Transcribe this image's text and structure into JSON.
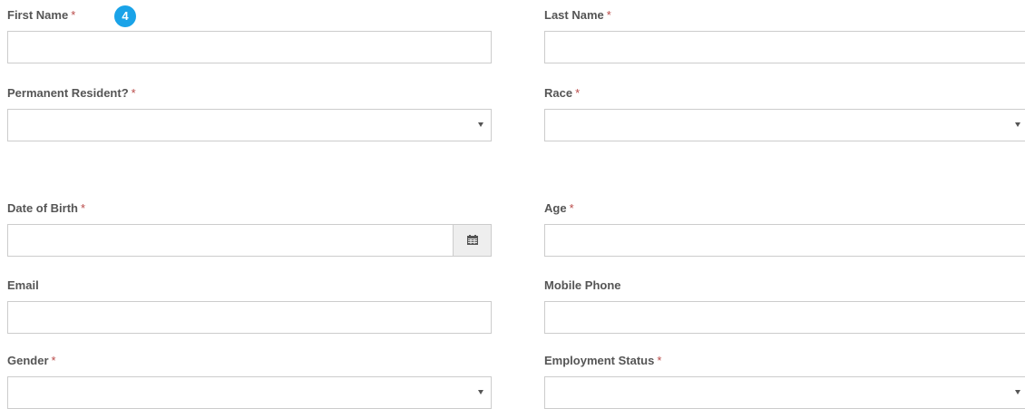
{
  "step_badge": "4",
  "required_marker": "*",
  "fields": {
    "first_name": {
      "label": "First Name",
      "value": ""
    },
    "last_name": {
      "label": "Last Name",
      "value": ""
    },
    "permanent_resident": {
      "label": "Permanent Resident?",
      "selected": ""
    },
    "race": {
      "label": "Race",
      "selected": ""
    },
    "date_of_birth": {
      "label": "Date of Birth",
      "value": "",
      "button_icon": "calendar-icon"
    },
    "age": {
      "label": "Age",
      "value": ""
    },
    "email": {
      "label": "Email",
      "value": ""
    },
    "mobile_phone": {
      "label": "Mobile Phone",
      "value": ""
    },
    "gender": {
      "label": "Gender",
      "selected": ""
    },
    "employment_status": {
      "label": "Employment Status",
      "selected": ""
    }
  },
  "colors": {
    "label": "#555555",
    "required": "#b94a48",
    "badge": "#1aa3e8",
    "border": "#cccccc",
    "addon_bg": "#eeeeee"
  }
}
